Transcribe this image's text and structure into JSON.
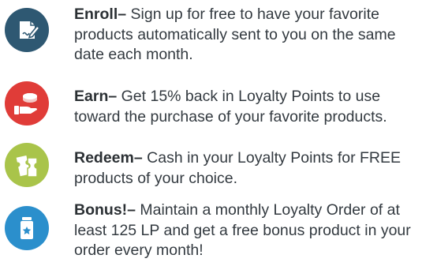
{
  "colors": {
    "enroll": "#2e5872",
    "earn": "#e03c38",
    "redeem": "#a9c44a",
    "bonus": "#2b8fcc",
    "text": "#333a40"
  },
  "steps": [
    {
      "icon": "document-pen-icon",
      "title": "Enroll–",
      "body": " Sign up for free to have your favorite products automatically sent to you on the same date each month."
    },
    {
      "icon": "hand-coin-icon",
      "title": "Earn–",
      "body": " Get 15% back in Loyalty Points to use toward the purchase of your favorite products."
    },
    {
      "icon": "tickets-icon",
      "title": "Redeem–",
      "body": " Cash in your Loyalty Points for FREE products of your choice."
    },
    {
      "icon": "product-bottle-icon",
      "title": "Bonus!–",
      "body": " Maintain a monthly Loyalty Order of at least 125 LP and get a free bonus product in your order every month!"
    }
  ]
}
